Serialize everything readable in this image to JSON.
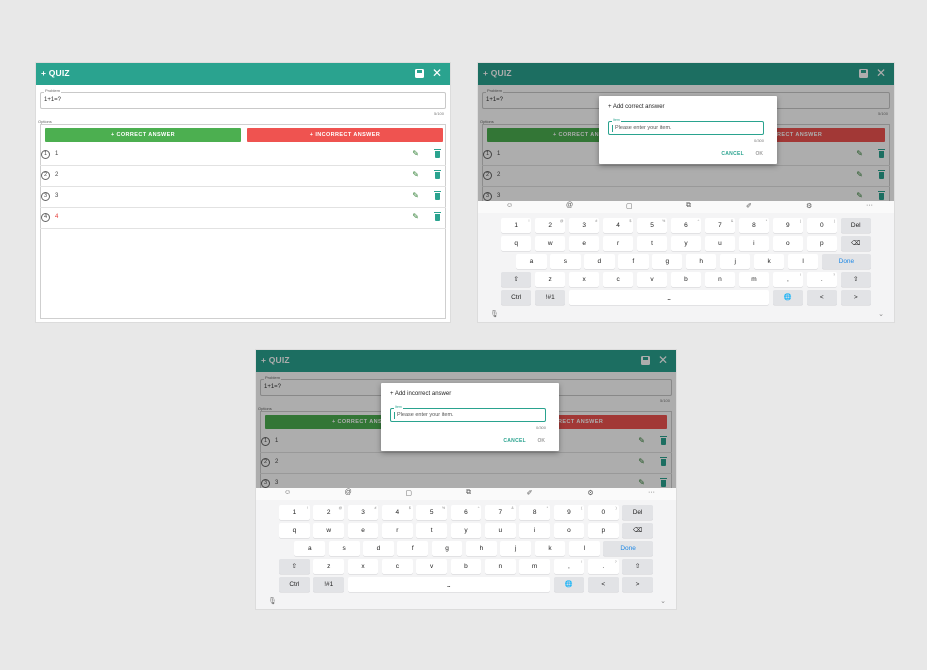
{
  "app": {
    "title": "+ QUIZ",
    "save_icon": "save-icon",
    "close_glyph": "✕",
    "colors": {
      "appbar": "#2aa38f",
      "correct": "#4caf50",
      "incorrect": "#ef5350"
    }
  },
  "problem": {
    "label": "Problem",
    "value": "1+1=?",
    "counter": "5/100"
  },
  "options_label": "Options",
  "buttons": {
    "correct": "+ CORRECT ANSWER",
    "incorrect": "+ INCORRECT ANSWER"
  },
  "answers": [
    {
      "num": "1",
      "text": "1",
      "correct": false
    },
    {
      "num": "2",
      "text": "2",
      "correct": false
    },
    {
      "num": "3",
      "text": "3",
      "correct": false
    },
    {
      "num": "4",
      "text": "4",
      "correct": true
    }
  ],
  "dialog_correct": {
    "title": "+ Add correct answer",
    "label": "Item",
    "placeholder": "Please enter your item.",
    "counter": "0/300",
    "cancel": "CANCEL",
    "ok": "OK"
  },
  "dialog_incorrect": {
    "title": "+ Add incorrect answer",
    "label": "Item",
    "placeholder": "Please enter your item.",
    "counter": "0/300",
    "cancel": "CANCEL",
    "ok": "OK"
  },
  "keyboard": {
    "toolbar": [
      "☺",
      "@",
      "▢",
      "⧉",
      "✐",
      "⚙",
      "···"
    ],
    "row1": [
      {
        "k": "1",
        "s": "!"
      },
      {
        "k": "2",
        "s": "@"
      },
      {
        "k": "3",
        "s": "#"
      },
      {
        "k": "4",
        "s": "$"
      },
      {
        "k": "5",
        "s": "%"
      },
      {
        "k": "6",
        "s": "^"
      },
      {
        "k": "7",
        "s": "&"
      },
      {
        "k": "8",
        "s": "*"
      },
      {
        "k": "9",
        "s": "("
      },
      {
        "k": "0",
        "s": ")"
      },
      {
        "k": "Del",
        "s": ""
      }
    ],
    "row2": [
      "q",
      "w",
      "e",
      "r",
      "t",
      "y",
      "u",
      "i",
      "o",
      "p",
      "⌫"
    ],
    "row3": [
      "a",
      "s",
      "d",
      "f",
      "g",
      "h",
      "j",
      "k",
      "l",
      "Done"
    ],
    "row4": [
      "⇧",
      "z",
      "x",
      "c",
      "v",
      "b",
      "n",
      "m",
      ",",
      ".",
      "⇧"
    ],
    "row4_sup": [
      "",
      "",
      "",
      "",
      "",
      "",
      "",
      "",
      "!",
      "?",
      ""
    ],
    "row5": [
      "Ctrl",
      "!#1",
      "⎵",
      "🌐",
      "<",
      ">"
    ],
    "mic": "🎙",
    "collapse": "⌄"
  }
}
